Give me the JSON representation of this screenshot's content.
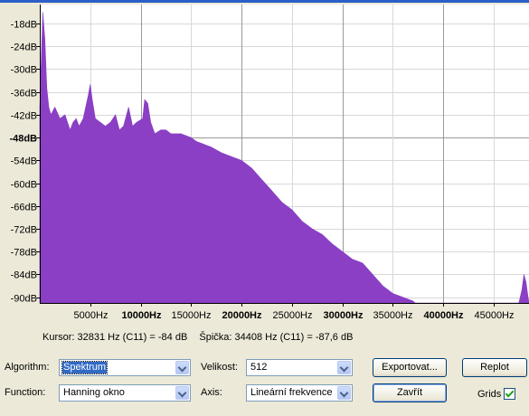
{
  "chart_data": {
    "type": "area",
    "fill_color": "#8a3fc4",
    "grid": true,
    "xlim": [
      0,
      48500
    ],
    "ylim": [
      -91.5,
      -13
    ],
    "y_ticks": [
      {
        "value": -18,
        "label": "-18dB",
        "major": false
      },
      {
        "value": -24,
        "label": "-24dB",
        "major": false
      },
      {
        "value": -30,
        "label": "-30dB",
        "major": false
      },
      {
        "value": -36,
        "label": "-36dB",
        "major": false
      },
      {
        "value": -42,
        "label": "-42dB",
        "major": false
      },
      {
        "value": -48,
        "label": "-48dB",
        "major": true
      },
      {
        "value": -54,
        "label": "-54dB",
        "major": false
      },
      {
        "value": -60,
        "label": "-60dB",
        "major": false
      },
      {
        "value": -66,
        "label": "-66dB",
        "major": false
      },
      {
        "value": -72,
        "label": "-72dB",
        "major": false
      },
      {
        "value": -78,
        "label": "-78dB",
        "major": false
      },
      {
        "value": -84,
        "label": "-84dB",
        "major": false
      },
      {
        "value": -90,
        "label": "-90dB",
        "major": false
      }
    ],
    "x_ticks": [
      {
        "value": 5000,
        "label": "5000Hz",
        "major": false
      },
      {
        "value": 10000,
        "label": "10000Hz",
        "major": true
      },
      {
        "value": 15000,
        "label": "15000Hz",
        "major": false
      },
      {
        "value": 20000,
        "label": "20000Hz",
        "major": true
      },
      {
        "value": 25000,
        "label": "25000Hz",
        "major": false
      },
      {
        "value": 30000,
        "label": "30000Hz",
        "major": true
      },
      {
        "value": 35000,
        "label": "35000Hz",
        "major": false
      },
      {
        "value": 40000,
        "label": "40000Hz",
        "major": true
      },
      {
        "value": 45000,
        "label": "45000Hz",
        "major": false
      }
    ],
    "x": [
      0,
      300,
      500,
      700,
      900,
      1100,
      1500,
      2000,
      2500,
      3000,
      3300,
      3600,
      3900,
      4300,
      4800,
      5000,
      5200,
      5500,
      6000,
      6500,
      7000,
      7500,
      7900,
      8300,
      8800,
      9200,
      9600,
      10200,
      10400,
      10700,
      11000,
      11400,
      12000,
      12500,
      13000,
      14000,
      15000,
      15500,
      16000,
      17000,
      18000,
      19000,
      20000,
      21000,
      22000,
      23000,
      24000,
      25000,
      26000,
      27000,
      28000,
      29000,
      30000,
      31000,
      32000,
      33000,
      34000,
      35000,
      36000,
      36500,
      37000,
      37200,
      47500,
      47800,
      48000,
      48200,
      48300,
      48500
    ],
    "y": [
      -40,
      -15,
      -22,
      -35,
      -40,
      -42,
      -40,
      -43,
      -42,
      -46,
      -44,
      -43,
      -45,
      -43,
      -37,
      -34,
      -38,
      -43,
      -44,
      -45,
      -44,
      -42,
      -46,
      -45,
      -40,
      -45,
      -44,
      -43,
      -38,
      -39,
      -44,
      -47,
      -46,
      -46,
      -47,
      -47,
      -48,
      -49,
      -49.5,
      -50.5,
      -52,
      -53,
      -54,
      -56,
      -59,
      -62,
      -65,
      -67,
      -70,
      -72,
      -73.5,
      -76,
      -78,
      -80,
      -81,
      -84,
      -87,
      -89,
      -90,
      -90.5,
      -91,
      -91.5,
      -91.5,
      -88,
      -84,
      -86,
      -88,
      -91.5
    ]
  },
  "status": {
    "cursor": "Kursor: 32831 Hz (C11) = -84 dB",
    "peak": "Špička: 34408 Hz (C11) = -87,6 dB"
  },
  "controls": {
    "algorithm_label": "Algorithm:",
    "algorithm_value": "Spektrum",
    "size_label": "Velikost:",
    "size_value": "512",
    "function_label": "Function:",
    "function_value": "Hanning okno",
    "axis_label": "Axis:",
    "axis_value": "Lineární frekvence",
    "export_button": "Exportovat...",
    "replot_button": "Replot",
    "close_button": "Zavřít",
    "grids_label": "Grids",
    "grids_checked": true
  }
}
